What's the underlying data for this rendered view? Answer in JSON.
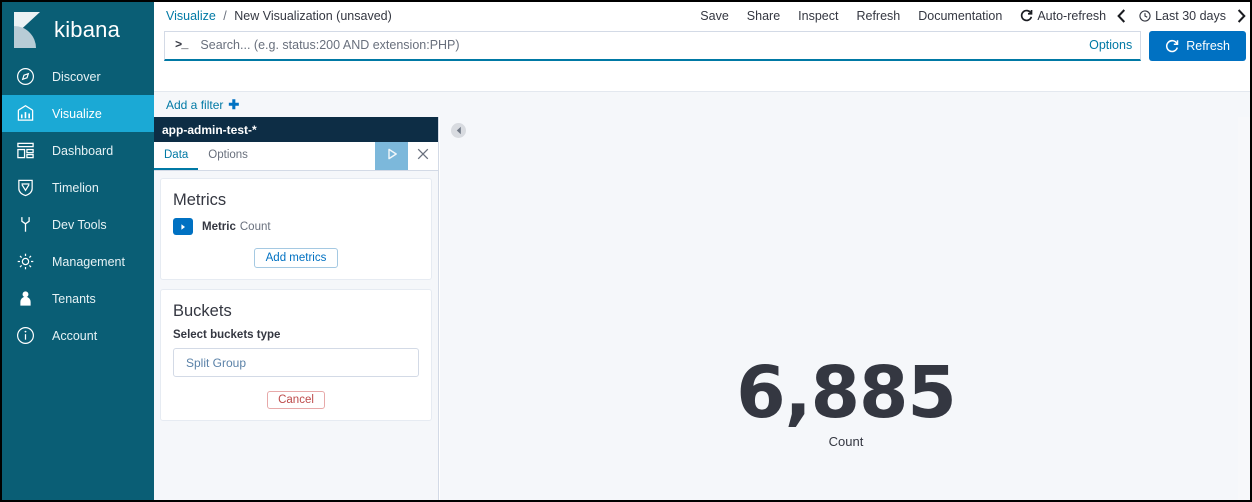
{
  "brand": {
    "name": "kibana",
    "logo_icon": "kibana-logo-icon"
  },
  "sidebar": {
    "items": [
      {
        "label": "Discover",
        "icon": "compass-icon",
        "active": false
      },
      {
        "label": "Visualize",
        "icon": "bar-chart-icon",
        "active": true
      },
      {
        "label": "Dashboard",
        "icon": "dashboard-icon",
        "active": false
      },
      {
        "label": "Timelion",
        "icon": "timelion-icon",
        "active": false
      },
      {
        "label": "Dev Tools",
        "icon": "wrench-icon",
        "active": false
      },
      {
        "label": "Management",
        "icon": "gear-icon",
        "active": false
      },
      {
        "label": "Tenants",
        "icon": "user-icon",
        "active": false
      },
      {
        "label": "Account",
        "icon": "info-icon",
        "active": false
      }
    ]
  },
  "breadcrumb": {
    "root": "Visualize",
    "separator": "/",
    "current": "New Visualization (unsaved)"
  },
  "topnav": {
    "items": [
      "Save",
      "Share",
      "Inspect",
      "Refresh",
      "Documentation"
    ],
    "autorefresh_label": "Auto-refresh",
    "autorefresh_icon": "refresh-cycle-icon",
    "prev_icon": "chevron-left-icon",
    "next_icon": "chevron-right-icon",
    "timepicker_label": "Last 30 days",
    "clock_icon": "clock-icon"
  },
  "query": {
    "prompt_icon": ">_",
    "value": "",
    "placeholder": "Search... (e.g. status:200 AND extension:PHP)",
    "options_label": "Options",
    "refresh_label": "Refresh",
    "refresh_icon": "refresh-icon"
  },
  "filterbar": {
    "add_filter_label": "Add a filter",
    "plus_icon": "plus-icon"
  },
  "editor": {
    "index_pattern": "app-admin-test-*",
    "tabs": [
      {
        "label": "Data",
        "active": true
      },
      {
        "label": "Options",
        "active": false
      }
    ],
    "apply_icon": "play-icon",
    "close_icon": "close-icon",
    "metrics": {
      "title": "Metrics",
      "rows": [
        {
          "toggle_icon": "triangle-right-icon",
          "label": "Metric",
          "value": "Count"
        }
      ],
      "add_label": "Add metrics"
    },
    "buckets": {
      "title": "Buckets",
      "field_label": "Select buckets type",
      "select_value": "Split Group",
      "cancel_label": "Cancel"
    }
  },
  "canvas": {
    "collapse_icon": "chevron-left-circle-icon",
    "drag_handle_icon": "drag-handle-icon"
  },
  "chart_data": {
    "type": "table",
    "title": "",
    "metric_value": "6,885",
    "metric_label": "Count"
  },
  "colors": {
    "sidebar_bg": "#0a5e75",
    "sidebar_active": "#1ba9d5",
    "index_header_bg": "#0d2d45",
    "accent_link": "#0079a5",
    "primary_button": "#0071c2",
    "panel_bg": "#f5f7fa",
    "danger": "#bd4b4b"
  }
}
